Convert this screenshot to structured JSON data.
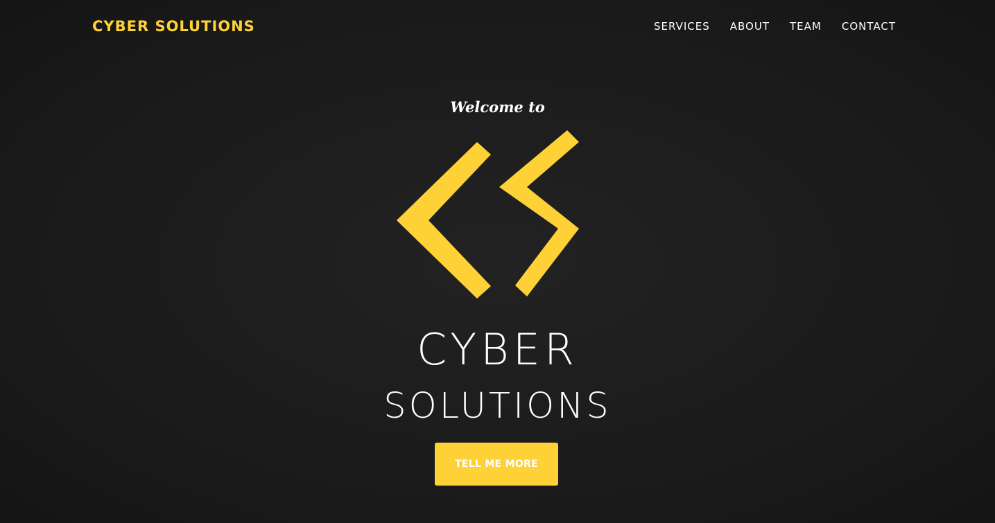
{
  "navbar": {
    "brand": "CYBER SOLUTIONS",
    "links": [
      {
        "label": "SERVICES"
      },
      {
        "label": "ABOUT"
      },
      {
        "label": "TEAM"
      },
      {
        "label": "CONTACT"
      }
    ]
  },
  "hero": {
    "welcome": "Welcome to",
    "logo_line1": "CYBER",
    "logo_line2": "SOLUTIONS",
    "cta_label": "TELL ME MORE"
  },
  "theme": {
    "accent": "#fed136",
    "background": "#1b1b1b",
    "text": "#ffffff"
  },
  "icons": {
    "logo": "cs-chevron-logo-icon"
  }
}
